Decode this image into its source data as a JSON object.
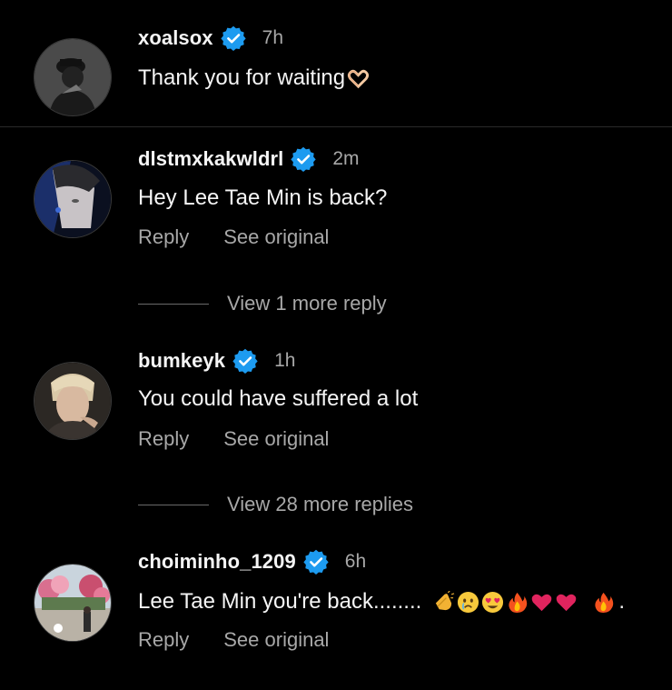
{
  "comments": [
    {
      "username": "xoalsox",
      "time": "7h",
      "text": "Thank you for waiting",
      "emoji": [
        "heart-hands"
      ],
      "has_actions": false
    },
    {
      "username": "dlstmxkakwldrl",
      "time": "2m",
      "text": "Hey Lee Tae Min is back?",
      "reply_label": "Reply",
      "see_original_label": "See original",
      "view_more": "View 1 more reply"
    },
    {
      "username": "bumkeyk",
      "time": "1h",
      "text": "You could have suffered a lot",
      "reply_label": "Reply",
      "see_original_label": "See original",
      "view_more": "View 28 more replies"
    },
    {
      "username": "choiminho_1209",
      "time": "6h",
      "text": "Lee Tae Min you're back........",
      "emoji": [
        "clapping-hands",
        "crying-face",
        "heart-eyes-face",
        "fire",
        "red-heart",
        "red-heart",
        "fire"
      ],
      "trailing": ".",
      "reply_label": "Reply",
      "see_original_label": "See original"
    }
  ],
  "colors": {
    "background": "#000000",
    "text_primary": "#f5f5f5",
    "text_secondary": "#a8a8a8",
    "verified_badge": "#1d9bf0",
    "divider": "#2a2a2a"
  }
}
